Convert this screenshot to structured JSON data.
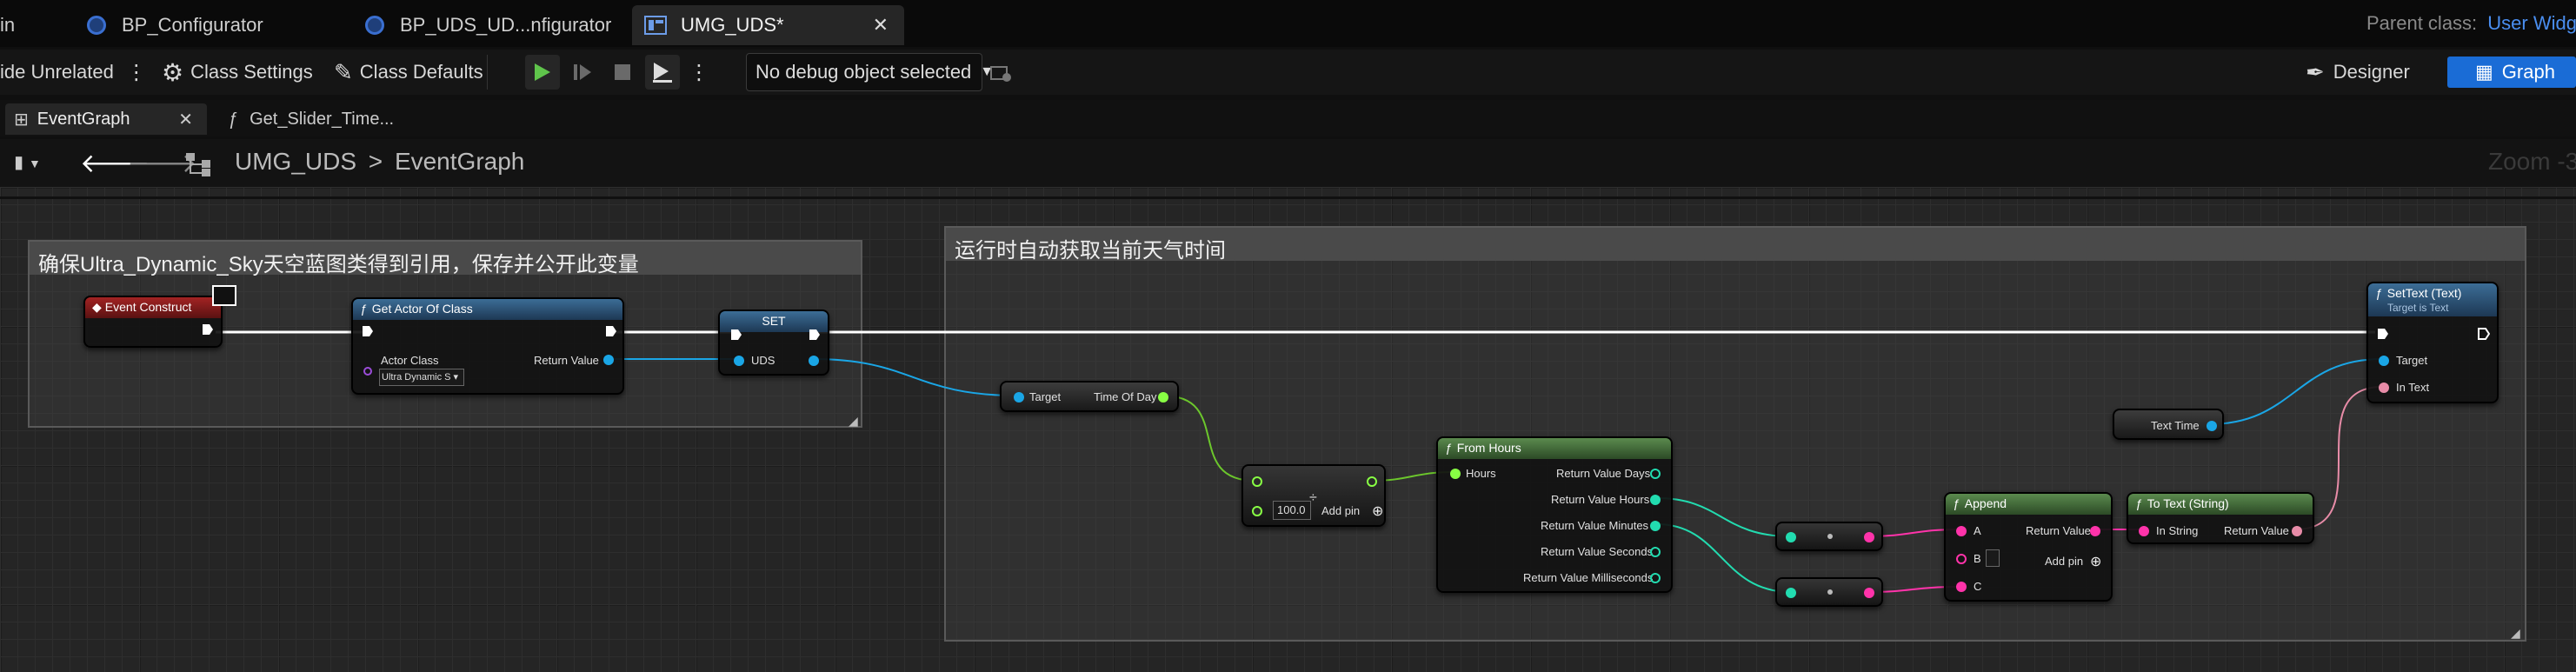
{
  "tabs": {
    "main": "in",
    "configurator": "BP_Configurator",
    "uds_configurator": "BP_UDS_UD...nfigurator",
    "umg": "UMG_UDS*",
    "parent_label": "Parent class:",
    "parent_value": "User Widget"
  },
  "toolbar": {
    "hide_unrelated": "ide Unrelated",
    "class_settings": "Class Settings",
    "class_defaults": "Class Defaults",
    "debug": "No debug object selected",
    "designer": "Designer",
    "graph": "Graph"
  },
  "doc_tabs": {
    "event_graph": "EventGraph",
    "slider_fn": "Get_Slider_Time..."
  },
  "breadcrumb": {
    "root": "UMG_UDS",
    "sep": ">",
    "current": "EventGraph",
    "zoom": "Zoom -3"
  },
  "comments": {
    "left": "确保Ultra_Dynamic_Sky天空蓝图类得到引用，保存并公开此变量",
    "right": "运行时自动获取当前天气时间"
  },
  "nodes": {
    "event_construct": "Event Construct",
    "get_actor": {
      "title": "Get Actor Of Class",
      "actor_class": "Actor Class",
      "actor_value": "Ultra Dynamic S",
      "return": "Return Value"
    },
    "set": {
      "title": "SET",
      "uds": "UDS"
    },
    "get_tod": {
      "target": "Target",
      "tod": "Time Of Day"
    },
    "divide": {
      "value": "100.0",
      "add_pin": "Add pin"
    },
    "from_hours": {
      "title": "From Hours",
      "hours": "Hours",
      "outputs": [
        "Return Value Days",
        "Return Value Hours",
        "Return Value Minutes",
        "Return Value Seconds",
        "Return Value Milliseconds"
      ]
    },
    "append": {
      "title": "Append",
      "a": "A",
      "b": "B",
      "c": "C",
      "return": "Return Value",
      "add_pin": "Add pin"
    },
    "to_text": {
      "title": "To Text (String)",
      "in": "In String",
      "return": "Return Value"
    },
    "text_time": "Text Time",
    "set_text": {
      "title": "SetText (Text)",
      "subtitle": "Target is Text",
      "target": "Target",
      "in_text": "In Text"
    }
  },
  "colors": {
    "exec": "#ffffff",
    "object": "#1aa6e6",
    "float": "#88ff44",
    "int": "#22dcb0",
    "string": "#ff33aa",
    "text": "#e88ca8",
    "accent": "#1a6cd6"
  }
}
